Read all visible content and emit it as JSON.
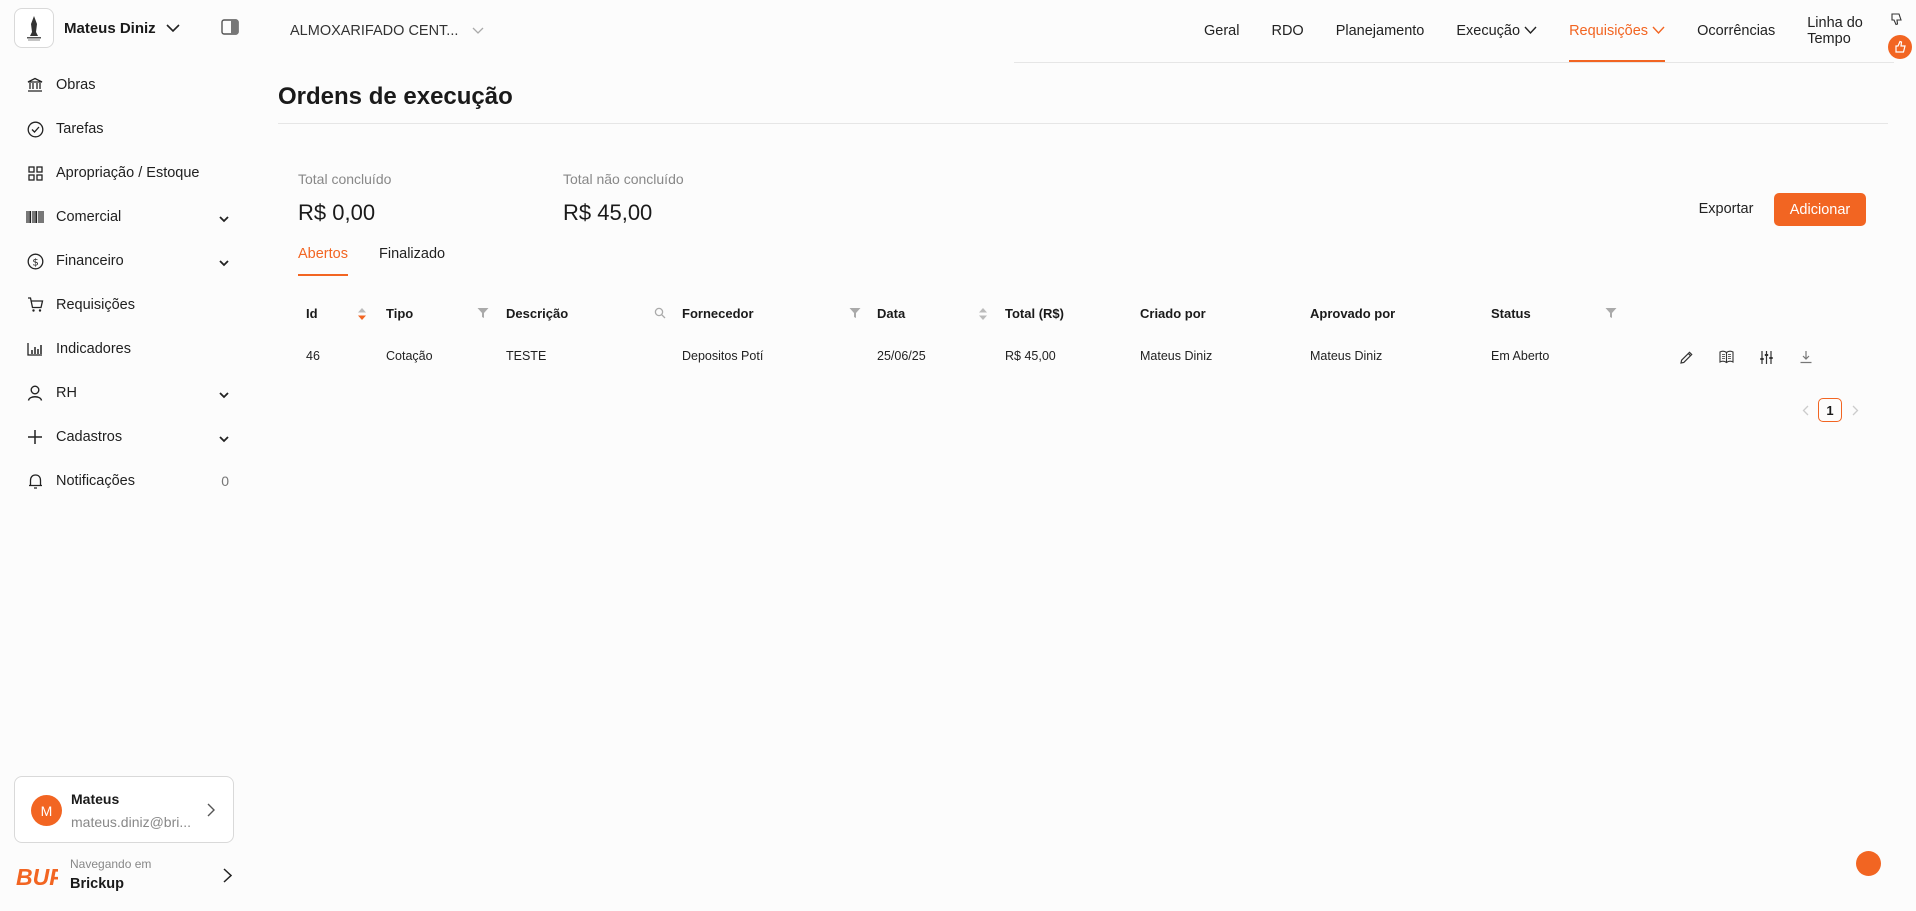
{
  "sidebar": {
    "user_name": "Mateus Diniz",
    "items": [
      {
        "label": "Obras",
        "icon": "bank-icon",
        "expandable": false
      },
      {
        "label": "Tarefas",
        "icon": "check-circle-icon",
        "expandable": false
      },
      {
        "label": "Apropriação / Estoque",
        "icon": "grid-icon",
        "expandable": false
      },
      {
        "label": "Comercial",
        "icon": "barcode-icon",
        "expandable": true
      },
      {
        "label": "Financeiro",
        "icon": "dollar-circle-icon",
        "expandable": true
      },
      {
        "label": "Requisições",
        "icon": "cart-icon",
        "expandable": false
      },
      {
        "label": "Indicadores",
        "icon": "bar-chart-icon",
        "expandable": false
      },
      {
        "label": "RH",
        "icon": "user-icon",
        "expandable": true
      },
      {
        "label": "Cadastros",
        "icon": "plus-icon",
        "expandable": true
      },
      {
        "label": "Notificações",
        "icon": "bell-icon",
        "expandable": false,
        "count": "0"
      }
    ],
    "profile": {
      "initial": "M",
      "name": "Mateus",
      "email": "mateus.diniz@bri..."
    },
    "footer": {
      "caption": "Navegando em",
      "company": "Brickup",
      "logo_text": "BUP"
    }
  },
  "topbar": {
    "project": "ALMOXARIFADO CENT...",
    "nav": [
      {
        "label": "Geral",
        "dropdown": false,
        "active": false
      },
      {
        "label": "RDO",
        "dropdown": false,
        "active": false
      },
      {
        "label": "Planejamento",
        "dropdown": false,
        "active": false
      },
      {
        "label": "Execução",
        "dropdown": true,
        "active": false
      },
      {
        "label": "Requisições",
        "dropdown": true,
        "active": true
      },
      {
        "label": "Ocorrências",
        "dropdown": false,
        "active": false
      },
      {
        "label": "Linha do Tempo",
        "dropdown": false,
        "active": false
      }
    ]
  },
  "main": {
    "title": "Ordens de execução",
    "stats": [
      {
        "label": "Total concluído",
        "value": "R$ 0,00"
      },
      {
        "label": "Total não concluído",
        "value": "R$ 45,00"
      }
    ],
    "export_label": "Exportar",
    "add_label": "Adicionar",
    "tabs": [
      {
        "label": "Abertos",
        "active": true
      },
      {
        "label": "Finalizado",
        "active": false
      }
    ],
    "table": {
      "columns": [
        "Id",
        "Tipo",
        "Descrição",
        "Fornecedor",
        "Data",
        "Total (R$)",
        "Criado por",
        "Aprovado por",
        "Status"
      ],
      "rows": [
        {
          "id": "46",
          "tipo": "Cotação",
          "descricao": "TESTE",
          "fornecedor": "Depositos Potí",
          "data": "25/06/25",
          "total": "R$ 45,00",
          "criado_por": "Mateus Diniz",
          "aprovado_por": "Mateus Diniz",
          "status": "Em Aberto"
        }
      ]
    },
    "pagination": {
      "current": "1"
    }
  },
  "colors": {
    "accent": "#f26522",
    "text": "#1a1a1a",
    "muted": "#888888",
    "border": "#d9d9d9"
  }
}
